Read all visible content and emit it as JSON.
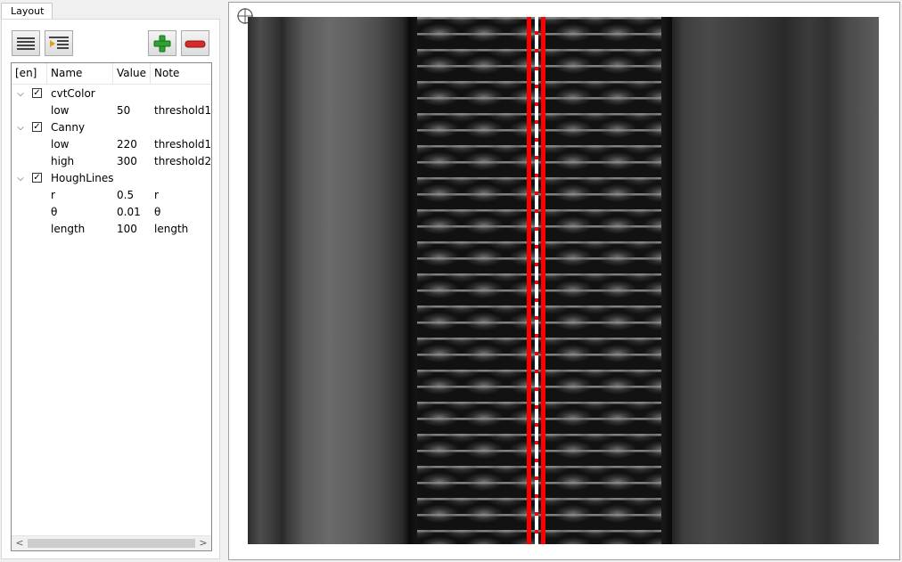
{
  "tab": {
    "label": "Layout"
  },
  "toolbar": {
    "buttons": [
      {
        "name": "list",
        "icon": "list-icon"
      },
      {
        "name": "indent",
        "icon": "indent-icon"
      },
      {
        "name": "add",
        "icon": "plus-icon",
        "color": "#2fa32f"
      },
      {
        "name": "remove",
        "icon": "minus-icon",
        "color": "#d62b2b"
      }
    ]
  },
  "tree": {
    "columns": [
      "[en]",
      "Name",
      "Value",
      "Note"
    ],
    "groups": [
      {
        "name": "cvtColor",
        "checked": true,
        "params": [
          {
            "name": "low",
            "value": "50",
            "note": "threshold1"
          }
        ]
      },
      {
        "name": "Canny",
        "checked": true,
        "params": [
          {
            "name": "low",
            "value": "220",
            "note": "threshold1"
          },
          {
            "name": "high",
            "value": "300",
            "note": "threshold2"
          }
        ]
      },
      {
        "name": "HoughLines",
        "checked": true,
        "params": [
          {
            "name": "r",
            "value": "0.5",
            "note": "r"
          },
          {
            "name": "θ",
            "value": "0.01",
            "note": "θ"
          },
          {
            "name": "length",
            "value": "100",
            "note": "length"
          }
        ]
      }
    ],
    "scroll_left": "<",
    "scroll_right": ">"
  },
  "viewer": {
    "crosshair_icon": "crosshair-icon",
    "detected_line_color": "#ff0000"
  }
}
